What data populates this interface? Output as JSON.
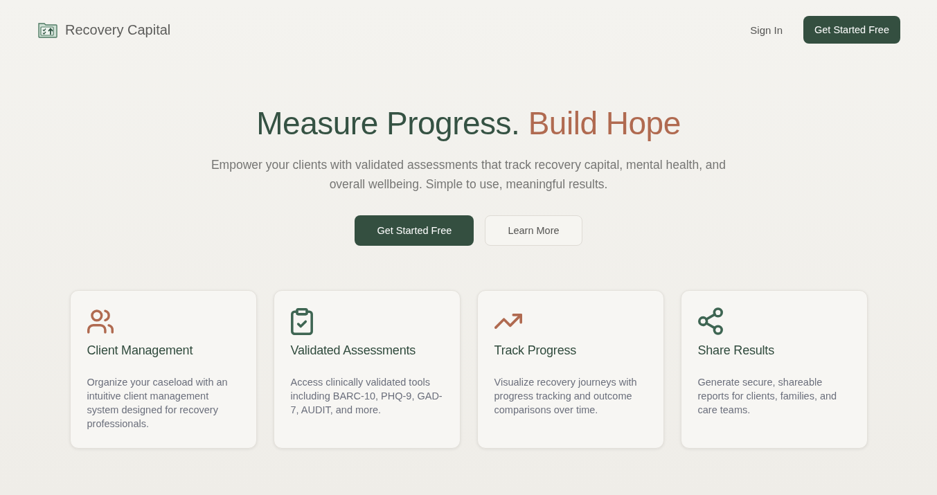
{
  "nav": {
    "brand": "Recovery Capital",
    "links": [
      {
        "kind": "text",
        "label": "Sign In"
      },
      {
        "kind": "primary",
        "label": "Get Started Free"
      }
    ]
  },
  "hero": {
    "headline": {
      "lead": "Measure Progress.",
      "accent": "Build Hope"
    },
    "subtitle": "Empower your clients with validated assessments that track recovery capital, mental health, and overall wellbeing. Simple to use, meaningful results.",
    "buttons": [
      {
        "kind": "primary",
        "label": "Get Started Free"
      },
      {
        "kind": "secondary",
        "label": "Learn More"
      }
    ]
  },
  "features": [
    {
      "kind": "people",
      "color": "#b06a50",
      "title": "Client Management",
      "description": "Organize your caseload with an intuitive client management system designed for recovery professionals."
    },
    {
      "kind": "clipboard",
      "color": "#3e6552",
      "title": "Validated Assessments",
      "description": "Access clinically validated tools including BARC-10, PHQ-9, GAD-7, AUDIT, and more."
    },
    {
      "kind": "trend",
      "color": "#b06a50",
      "title": "Track Progress",
      "description": "Visualize recovery journeys with progress tracking and outcome comparisons over time."
    },
    {
      "kind": "share",
      "color": "#3e6552",
      "title": "Share Results",
      "description": "Generate secure, shareable reports for clients, families, and care teams."
    }
  ]
}
